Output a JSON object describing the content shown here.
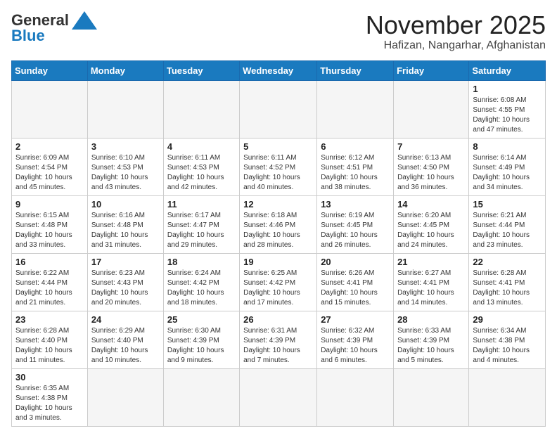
{
  "header": {
    "logo_general": "General",
    "logo_blue": "Blue",
    "month_title": "November 2025",
    "location": "Hafizan, Nangarhar, Afghanistan"
  },
  "weekdays": [
    "Sunday",
    "Monday",
    "Tuesday",
    "Wednesday",
    "Thursday",
    "Friday",
    "Saturday"
  ],
  "rows": [
    [
      {
        "day": "",
        "info": ""
      },
      {
        "day": "",
        "info": ""
      },
      {
        "day": "",
        "info": ""
      },
      {
        "day": "",
        "info": ""
      },
      {
        "day": "",
        "info": ""
      },
      {
        "day": "",
        "info": ""
      },
      {
        "day": "1",
        "info": "Sunrise: 6:08 AM\nSunset: 4:55 PM\nDaylight: 10 hours and 47 minutes."
      }
    ],
    [
      {
        "day": "2",
        "info": "Sunrise: 6:09 AM\nSunset: 4:54 PM\nDaylight: 10 hours and 45 minutes."
      },
      {
        "day": "3",
        "info": "Sunrise: 6:10 AM\nSunset: 4:53 PM\nDaylight: 10 hours and 43 minutes."
      },
      {
        "day": "4",
        "info": "Sunrise: 6:11 AM\nSunset: 4:53 PM\nDaylight: 10 hours and 42 minutes."
      },
      {
        "day": "5",
        "info": "Sunrise: 6:11 AM\nSunset: 4:52 PM\nDaylight: 10 hours and 40 minutes."
      },
      {
        "day": "6",
        "info": "Sunrise: 6:12 AM\nSunset: 4:51 PM\nDaylight: 10 hours and 38 minutes."
      },
      {
        "day": "7",
        "info": "Sunrise: 6:13 AM\nSunset: 4:50 PM\nDaylight: 10 hours and 36 minutes."
      },
      {
        "day": "8",
        "info": "Sunrise: 6:14 AM\nSunset: 4:49 PM\nDaylight: 10 hours and 34 minutes."
      }
    ],
    [
      {
        "day": "9",
        "info": "Sunrise: 6:15 AM\nSunset: 4:48 PM\nDaylight: 10 hours and 33 minutes."
      },
      {
        "day": "10",
        "info": "Sunrise: 6:16 AM\nSunset: 4:48 PM\nDaylight: 10 hours and 31 minutes."
      },
      {
        "day": "11",
        "info": "Sunrise: 6:17 AM\nSunset: 4:47 PM\nDaylight: 10 hours and 29 minutes."
      },
      {
        "day": "12",
        "info": "Sunrise: 6:18 AM\nSunset: 4:46 PM\nDaylight: 10 hours and 28 minutes."
      },
      {
        "day": "13",
        "info": "Sunrise: 6:19 AM\nSunset: 4:45 PM\nDaylight: 10 hours and 26 minutes."
      },
      {
        "day": "14",
        "info": "Sunrise: 6:20 AM\nSunset: 4:45 PM\nDaylight: 10 hours and 24 minutes."
      },
      {
        "day": "15",
        "info": "Sunrise: 6:21 AM\nSunset: 4:44 PM\nDaylight: 10 hours and 23 minutes."
      }
    ],
    [
      {
        "day": "16",
        "info": "Sunrise: 6:22 AM\nSunset: 4:44 PM\nDaylight: 10 hours and 21 minutes."
      },
      {
        "day": "17",
        "info": "Sunrise: 6:23 AM\nSunset: 4:43 PM\nDaylight: 10 hours and 20 minutes."
      },
      {
        "day": "18",
        "info": "Sunrise: 6:24 AM\nSunset: 4:42 PM\nDaylight: 10 hours and 18 minutes."
      },
      {
        "day": "19",
        "info": "Sunrise: 6:25 AM\nSunset: 4:42 PM\nDaylight: 10 hours and 17 minutes."
      },
      {
        "day": "20",
        "info": "Sunrise: 6:26 AM\nSunset: 4:41 PM\nDaylight: 10 hours and 15 minutes."
      },
      {
        "day": "21",
        "info": "Sunrise: 6:27 AM\nSunset: 4:41 PM\nDaylight: 10 hours and 14 minutes."
      },
      {
        "day": "22",
        "info": "Sunrise: 6:28 AM\nSunset: 4:41 PM\nDaylight: 10 hours and 13 minutes."
      }
    ],
    [
      {
        "day": "23",
        "info": "Sunrise: 6:28 AM\nSunset: 4:40 PM\nDaylight: 10 hours and 11 minutes."
      },
      {
        "day": "24",
        "info": "Sunrise: 6:29 AM\nSunset: 4:40 PM\nDaylight: 10 hours and 10 minutes."
      },
      {
        "day": "25",
        "info": "Sunrise: 6:30 AM\nSunset: 4:39 PM\nDaylight: 10 hours and 9 minutes."
      },
      {
        "day": "26",
        "info": "Sunrise: 6:31 AM\nSunset: 4:39 PM\nDaylight: 10 hours and 7 minutes."
      },
      {
        "day": "27",
        "info": "Sunrise: 6:32 AM\nSunset: 4:39 PM\nDaylight: 10 hours and 6 minutes."
      },
      {
        "day": "28",
        "info": "Sunrise: 6:33 AM\nSunset: 4:39 PM\nDaylight: 10 hours and 5 minutes."
      },
      {
        "day": "29",
        "info": "Sunrise: 6:34 AM\nSunset: 4:38 PM\nDaylight: 10 hours and 4 minutes."
      }
    ],
    [
      {
        "day": "30",
        "info": "Sunrise: 6:35 AM\nSunset: 4:38 PM\nDaylight: 10 hours and 3 minutes."
      },
      {
        "day": "",
        "info": ""
      },
      {
        "day": "",
        "info": ""
      },
      {
        "day": "",
        "info": ""
      },
      {
        "day": "",
        "info": ""
      },
      {
        "day": "",
        "info": ""
      },
      {
        "day": "",
        "info": ""
      }
    ]
  ]
}
